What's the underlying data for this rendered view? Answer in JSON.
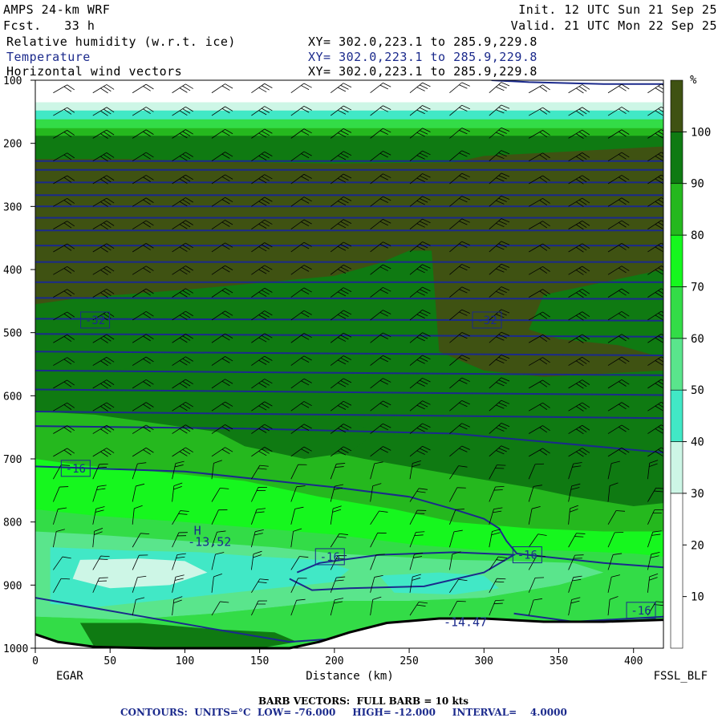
{
  "header": {
    "model": "AMPS 24-km WRF",
    "fcst": "Fcst.   33 h",
    "init": "Init. 12 UTC Sun 21 Sep 25",
    "valid": "Valid. 21 UTC Mon 22 Sep 25",
    "fields": [
      {
        "name": "Relative humidity (w.r.t. ice)",
        "xy": "XY= 302.0,223.1 to 285.9,229.8",
        "color": "#000000"
      },
      {
        "name": "Temperature",
        "xy": "XY= 302.0,223.1 to 285.9,229.8",
        "color": "#1b2a8c"
      },
      {
        "name": "Horizontal wind vectors",
        "xy": "XY= 302.0,223.1 to 285.9,229.8",
        "color": "#000000"
      }
    ]
  },
  "footer": {
    "barb": "BARB VECTORS:  FULL BARB = 10 kts",
    "contours": "CONTOURS:  UNITS=°C  LOW= -76.000     HIGH= -12.000     INTERVAL=    4.0000",
    "left_station": "EGAR",
    "right_station": "FSSL_BLF"
  },
  "chart_data": {
    "type": "heatmap",
    "title": "Relative humidity (w.r.t. ice)",
    "xlabel": "Distance (km)",
    "ylabel": "",
    "xlim": [
      0,
      420
    ],
    "ylim": [
      1000,
      100
    ],
    "x_ticks": [
      0,
      50,
      100,
      150,
      200,
      250,
      300,
      350,
      400
    ],
    "y_ticks": [
      100,
      200,
      300,
      400,
      500,
      600,
      700,
      800,
      900,
      1000
    ],
    "colorbar": {
      "unit": "%",
      "ticks": [
        10,
        20,
        30,
        40,
        50,
        60,
        70,
        80,
        90,
        100
      ],
      "levels": [
        {
          "from": 0,
          "to": 30,
          "color": "#ffffff"
        },
        {
          "from": 30,
          "to": 40,
          "color": "#cdf6e6"
        },
        {
          "from": 40,
          "to": 50,
          "color": "#41e8c6"
        },
        {
          "from": 50,
          "to": 60,
          "color": "#5ae58c"
        },
        {
          "from": 60,
          "to": 70,
          "color": "#33dc47"
        },
        {
          "from": 70,
          "to": 80,
          "color": "#16f71e"
        },
        {
          "from": 80,
          "to": 90,
          "color": "#25b81e"
        },
        {
          "from": 90,
          "to": 100,
          "color": "#0f7a12"
        },
        {
          "from": 100,
          "to": 110,
          "color": "#3f5212"
        }
      ]
    },
    "contour_labels": [
      {
        "text": "-32",
        "x": 40,
        "p": 480
      },
      {
        "text": "-32",
        "x": 302,
        "p": 480
      },
      {
        "text": "-16",
        "x": 27,
        "p": 715
      },
      {
        "text": "-16",
        "x": 197,
        "p": 855
      },
      {
        "text": "-16",
        "x": 329,
        "p": 852
      },
      {
        "text": "-16",
        "x": 405,
        "p": 940
      }
    ],
    "annotations": [
      {
        "text": "H",
        "x": 106,
        "p": 820
      },
      {
        "text": "-13.52",
        "x": 102,
        "p": 838
      },
      {
        "text": "-14.47",
        "x": 273,
        "p": 965
      }
    ]
  }
}
